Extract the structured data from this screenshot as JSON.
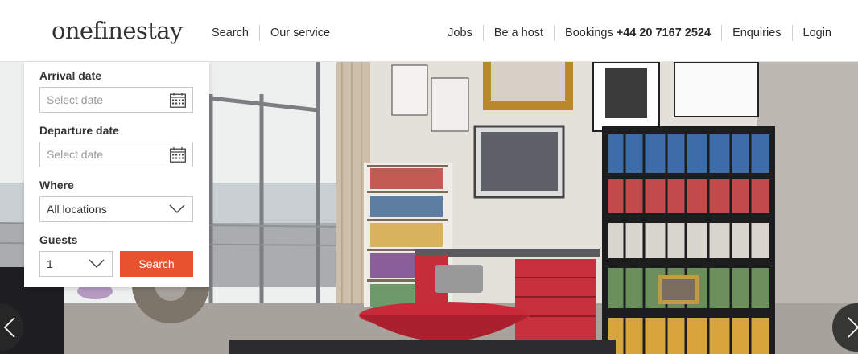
{
  "brand": {
    "logo_text": "onefinestay"
  },
  "nav_left": [
    {
      "label": "Search"
    },
    {
      "label": "Our service"
    }
  ],
  "nav_right": {
    "jobs": "Jobs",
    "host": "Be a host",
    "bookings_label": "Bookings",
    "bookings_phone": "+44 20 7167 2524",
    "enquiries": "Enquiries",
    "login": "Login"
  },
  "search_panel": {
    "arrival": {
      "label": "Arrival date",
      "placeholder": "Select date"
    },
    "departure": {
      "label": "Departure date",
      "placeholder": "Select date"
    },
    "where": {
      "label": "Where",
      "value": "All locations"
    },
    "guests": {
      "label": "Guests",
      "value": "1"
    },
    "submit_label": "Search"
  },
  "colors": {
    "accent": "#e8522e",
    "header_bg": "#ffffff",
    "text": "#222222"
  },
  "icons": {
    "calendar": "calendar-icon",
    "chevron": "chevron-down-icon",
    "prev": "chevron-left-icon",
    "next": "chevron-right-icon"
  }
}
